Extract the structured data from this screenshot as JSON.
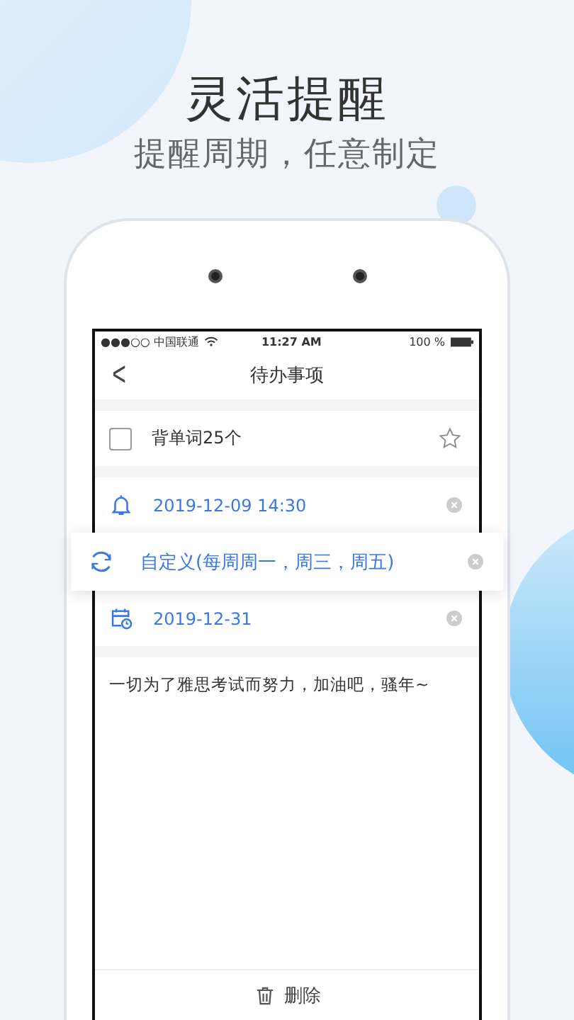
{
  "headline": "灵活提醒",
  "subtitle": "提醒周期，任意制定",
  "status_bar": {
    "carrier": "●●●○○ 中国联通",
    "time": "11:27 AM",
    "battery": "100 %"
  },
  "nav": {
    "back": "<",
    "title": "待办事项"
  },
  "todo": {
    "text": "背单词25个",
    "checked": false,
    "starred": false
  },
  "reminder": {
    "text": "2019-12-09 14:30"
  },
  "repeat": {
    "text": "自定义(每周周一，周三，周五)",
    "selected": true
  },
  "end_date": {
    "text": "2019-12-31"
  },
  "note": "一切为了雅思考试而努力，加油吧，骚年~",
  "delete_button": "删除"
}
